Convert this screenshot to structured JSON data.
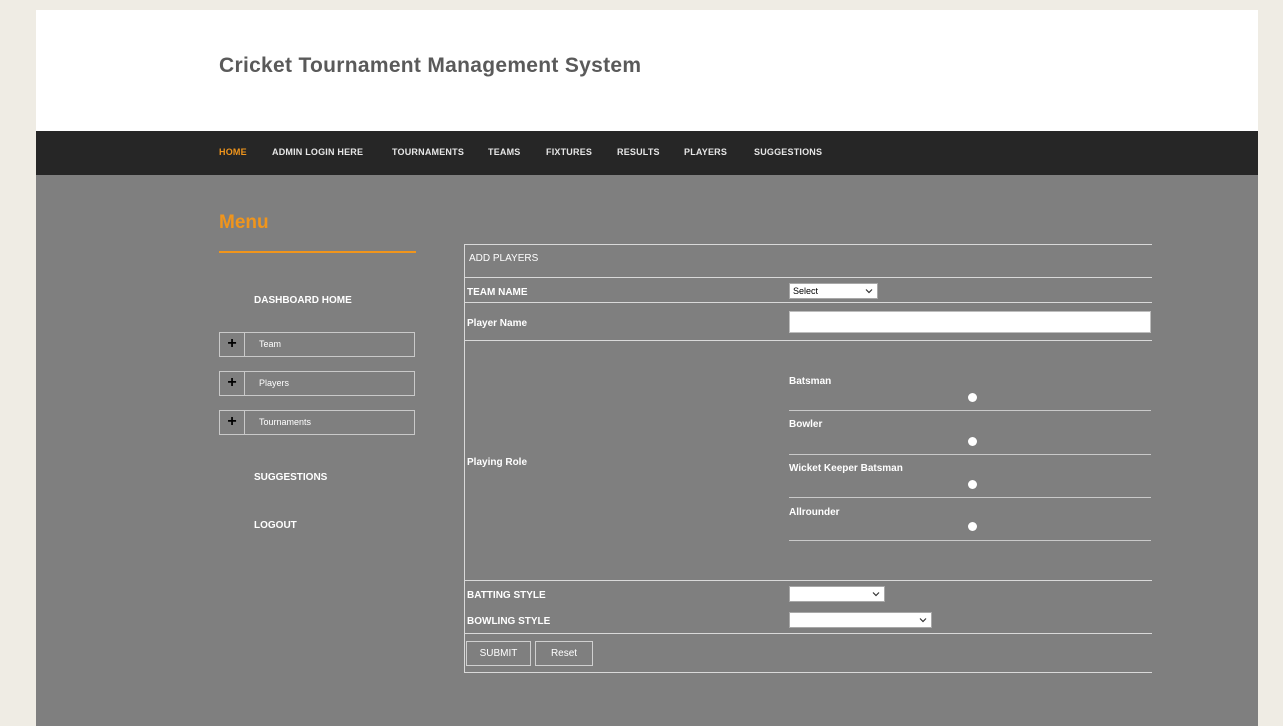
{
  "header": {
    "title": "Cricket Tournament Management System"
  },
  "nav": {
    "home": "HOME",
    "admin_login": "ADMIN LOGIN HERE",
    "tournaments": "TOURNAMENTS",
    "teams": "TEAMS",
    "fixtures": "FIXTURES",
    "results": "RESULTS",
    "players": "PLAYERS",
    "suggestions": "SUGGESTIONS"
  },
  "sidebar": {
    "title": "Menu",
    "dashboard_home": "DASHBOARD HOME",
    "groups": [
      {
        "label": "Team",
        "icon": "plus-icon"
      },
      {
        "label": "Players",
        "icon": "plus-icon"
      },
      {
        "label": "Tournaments",
        "icon": "plus-icon"
      }
    ],
    "suggestions": "SUGGESTIONS",
    "logout": "LOGOUT"
  },
  "form": {
    "heading": "ADD PLAYERS",
    "team_name_label": "TEAM NAME",
    "team_name_value": "Select",
    "player_name_label": "Player Name",
    "player_name_value": "",
    "playing_role_label": "Playing Role",
    "roles": [
      "Batsman",
      "Bowler",
      "Wicket Keeper Batsman",
      "Allrounder"
    ],
    "batting_style_label": "BATTING STYLE",
    "batting_style_value": "",
    "bowling_style_label": "BOWLING STYLE",
    "bowling_style_value": "",
    "submit_label": "SUBMIT",
    "reset_label": "Reset"
  },
  "colors": {
    "accent": "#f0951c",
    "navbar": "#262626",
    "content_bg": "#7f7f7f"
  }
}
